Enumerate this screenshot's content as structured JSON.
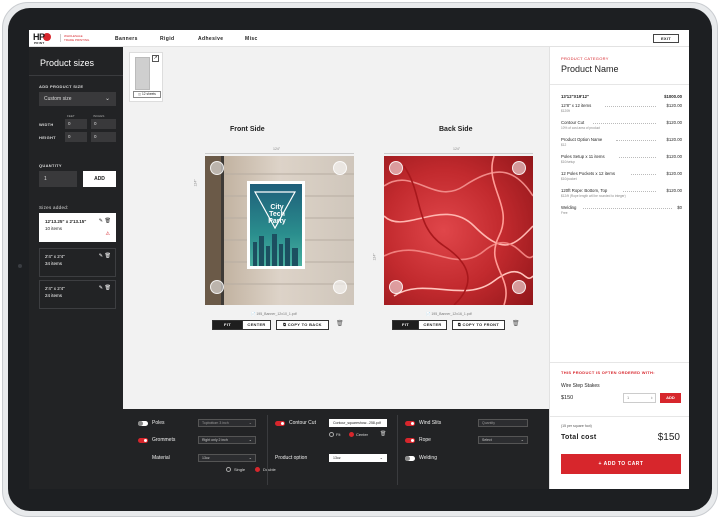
{
  "nav": {
    "logo_main": "HP",
    "logo_sub": "PRINT",
    "logo_tag": [
      "WHOLESALE",
      "TRADE PRINTING"
    ],
    "links": [
      "Banners",
      "Rigid",
      "Adhesive",
      "Misc"
    ],
    "exit_label": "EXIT"
  },
  "sidebar": {
    "title": "Product sizes",
    "add_size_label": "ADD PRODUCT SIZE",
    "size_select": "Custom size",
    "feet_label": "FEET",
    "inches_label": "INCHES",
    "width_label": "WIDTH",
    "height_label": "HEIGHT",
    "width_feet": "0",
    "width_inches": "0",
    "height_feet": "0",
    "height_inches": "0",
    "quantity_label": "QUANTITY",
    "quantity_value": "1",
    "add_label": "ADD",
    "sizes_added_label": "Sizes added:",
    "sizes": [
      {
        "dim": "12'13.25\" x 2'13.15\"",
        "items": "10 items",
        "warning": true
      },
      {
        "dim": "2'4\" x 2'4\"",
        "items": "34 items",
        "warning": false
      },
      {
        "dim": "2'4\" x 2'4\"",
        "items": "24 items",
        "warning": false
      }
    ]
  },
  "canvas": {
    "sheets_label": "12 sheets",
    "front": {
      "title": "Front Side",
      "width_dim": "124\"",
      "height_dim": "124\"",
      "file": "195_Banner_12x10_1.pdf",
      "poster_line1": "City",
      "poster_line2": "Tech",
      "poster_line3": "Party",
      "fit": "FIT",
      "center": "CENTER",
      "copy": "COPY TO BACK"
    },
    "back": {
      "title": "Back Side",
      "width_dim": "124\"",
      "height_dim": "124\"",
      "file": "195_Banner_12x16_1.pdf",
      "fit": "FIT",
      "center": "CENTER",
      "copy": "COPY TO FRONT"
    }
  },
  "options": {
    "poles": {
      "label": "Poles",
      "on": false,
      "value": "Topbottom 3 inch"
    },
    "grommets": {
      "label": "Grommets",
      "on": true,
      "value": "Right only 2 inch"
    },
    "material": {
      "label": "Material",
      "value": "13oz",
      "radios": [
        "Single",
        "Double"
      ],
      "selected": "Double"
    },
    "contour": {
      "label": "Contour Cut",
      "on": true,
      "value": "Contour_squareshow...258.pdf",
      "radios": [
        "Fit",
        "Center"
      ],
      "selected": "Center"
    },
    "product_option": {
      "label": "Product option",
      "value": "13oz"
    },
    "wind_slits": {
      "label": "Wind Slits",
      "on": true,
      "value": "Quantity"
    },
    "rope": {
      "label": "Rope",
      "on": true,
      "value": "Select"
    },
    "welding": {
      "label": "Welding",
      "on": false
    }
  },
  "summary": {
    "category_label": "PRODUCT CATEGORY",
    "product_name": "Product Name",
    "header_size": "13'12\"X19'12\"",
    "header_price": "$1000.00",
    "lines": [
      {
        "name": "12'8\" x 12 items",
        "price": "$120.00",
        "sub": "$120ft"
      },
      {
        "name": "Contour Cut",
        "price": "$120.00",
        "sub": "10% of cost area of product"
      },
      {
        "name": "Product Option Name",
        "price": "$120.00",
        "sub": "$12"
      },
      {
        "name": "Poles Setup x 11 items",
        "price": "$120.00",
        "sub": "$10/setup"
      },
      {
        "name": "12 Poles Pockets x 12 items",
        "price": "$120.00",
        "sub": "$10/pocket"
      },
      {
        "name": "120ft Rope: Bottom, Top",
        "price": "$120.00",
        "sub": "$12/ft (Rope length will be rounded to integer)"
      },
      {
        "name": "Welding",
        "price": "$0",
        "sub": "Free"
      }
    ],
    "often_label": "THIS PRODUCT IS OFTEN ORDERED WITH:",
    "upsell_name": "Wire Step Stakes",
    "upsell_price": "$150",
    "upsell_qty": "1",
    "upsell_add": "ADD",
    "total_note": "(15 per square foot)",
    "total_label": "Total cost",
    "total_value": "$150",
    "cart_label": "ADD TO CART"
  },
  "colors": {
    "accent": "#d7262c",
    "dark": "#222325"
  }
}
